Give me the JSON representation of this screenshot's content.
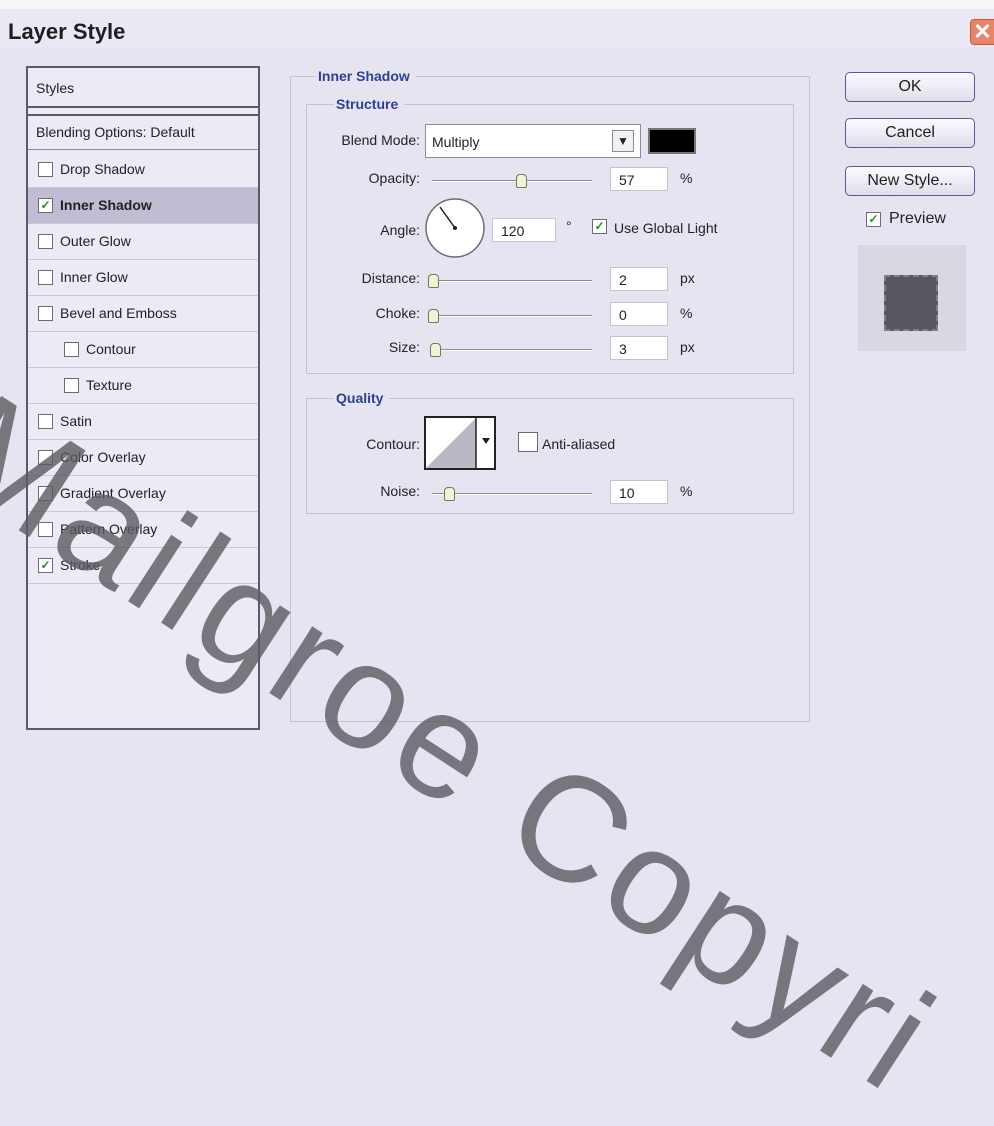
{
  "window": {
    "title": "Layer Style",
    "close_glyph": "✕"
  },
  "styles_panel": {
    "header": "Styles",
    "blending_options": "Blending Options: Default",
    "items": [
      {
        "label": "Drop Shadow",
        "checked": false
      },
      {
        "label": "Inner Shadow",
        "checked": true,
        "selected": true
      },
      {
        "label": "Outer Glow",
        "checked": false
      },
      {
        "label": "Inner Glow",
        "checked": false
      },
      {
        "label": "Bevel and Emboss",
        "checked": false
      },
      {
        "label": "Contour",
        "checked": false,
        "sub": true
      },
      {
        "label": "Texture",
        "checked": false,
        "sub": true
      },
      {
        "label": "Satin",
        "checked": false
      },
      {
        "label": "Color Overlay",
        "checked": false
      },
      {
        "label": "Gradient Overlay",
        "checked": false
      },
      {
        "label": "Pattern Overlay",
        "checked": false
      },
      {
        "label": "Stroke",
        "checked": true
      }
    ]
  },
  "inner_shadow": {
    "title": "Inner Shadow",
    "structure": {
      "title": "Structure",
      "blend_mode_label": "Blend Mode:",
      "blend_mode_value": "Multiply",
      "shadow_color": "#000000",
      "opacity_label": "Opacity:",
      "opacity_value": "57",
      "opacity_unit": "%",
      "angle_label": "Angle:",
      "angle_value": "120",
      "angle_unit": "°",
      "use_global_light_label": "Use Global Light",
      "use_global_light_checked": true,
      "distance_label": "Distance:",
      "distance_value": "2",
      "distance_unit": "px",
      "choke_label": "Choke:",
      "choke_value": "0",
      "choke_unit": "%",
      "size_label": "Size:",
      "size_value": "3",
      "size_unit": "px"
    },
    "quality": {
      "title": "Quality",
      "contour_label": "Contour:",
      "anti_aliased_label": "Anti-aliased",
      "anti_aliased_checked": false,
      "noise_label": "Noise:",
      "noise_value": "10",
      "noise_unit": "%"
    }
  },
  "buttons": {
    "ok": "OK",
    "cancel": "Cancel",
    "new_style": "New Style..."
  },
  "preview": {
    "label": "Preview",
    "checked": true
  },
  "watermark": "Mailgroe Copyri",
  "icons": {
    "checkmark": "✓",
    "dropdown_arrow": "▼"
  }
}
